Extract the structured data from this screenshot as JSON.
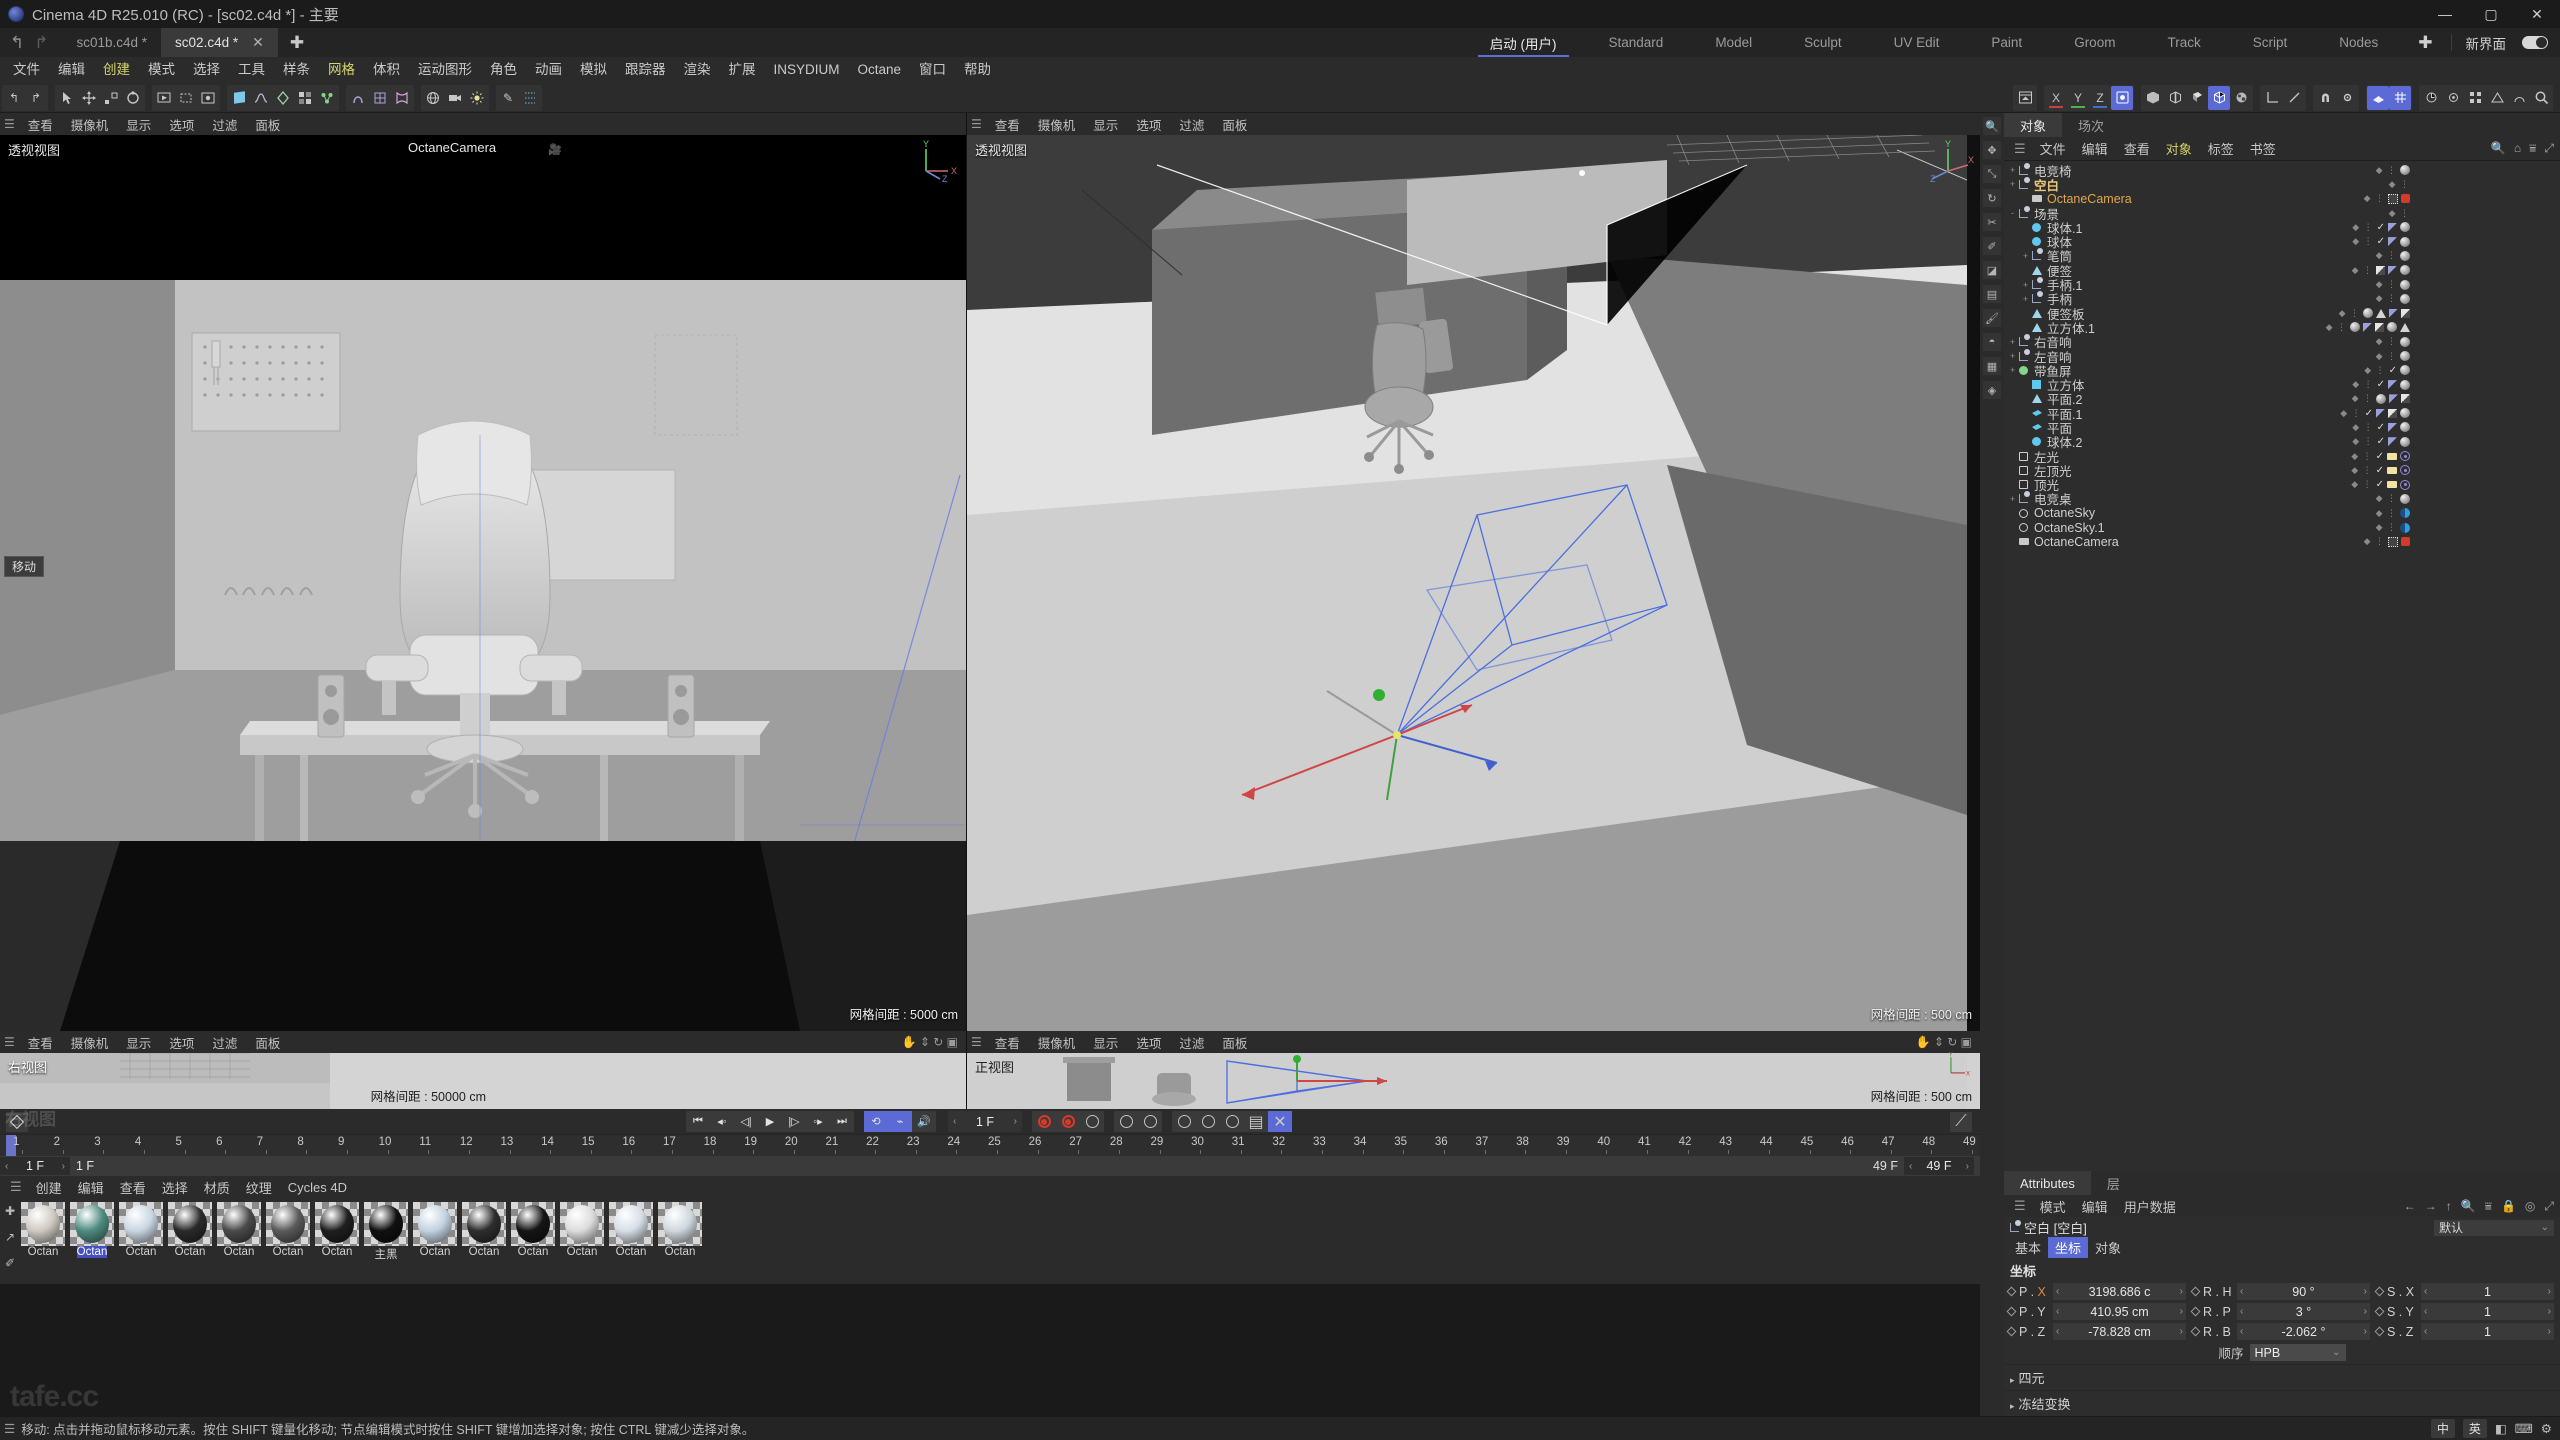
{
  "window": {
    "title": "Cinema 4D R25.010 (RC) - [sc02.c4d *] - 主要",
    "minimize": "—",
    "maximize": "▢",
    "close": "✕"
  },
  "tabs": {
    "undo_icon": "↰",
    "redo_icon": "↱",
    "documents": [
      {
        "label": "sc01b.c4d *",
        "active": false
      },
      {
        "label": "sc02.c4d *",
        "active": true,
        "close": "✕"
      }
    ],
    "add_tab": "✚"
  },
  "layouts": {
    "items": [
      {
        "label": "启动 (用户)",
        "active": true
      },
      {
        "label": "Standard",
        "active": false
      },
      {
        "label": "Model",
        "active": false
      },
      {
        "label": "Sculpt",
        "active": false
      },
      {
        "label": "UV Edit",
        "active": false
      },
      {
        "label": "Paint",
        "active": false
      },
      {
        "label": "Groom",
        "active": false
      },
      {
        "label": "Track",
        "active": false
      },
      {
        "label": "Script",
        "active": false
      },
      {
        "label": "Nodes",
        "active": false
      }
    ],
    "add": "✚",
    "new_ui_label": "新界面"
  },
  "menubar": {
    "items": [
      {
        "label": "文件",
        "highlight": false
      },
      {
        "label": "编辑",
        "highlight": false
      },
      {
        "label": "创建",
        "highlight": true
      },
      {
        "label": "模式",
        "highlight": false
      },
      {
        "label": "选择",
        "highlight": false
      },
      {
        "label": "工具",
        "highlight": false
      },
      {
        "label": "样条",
        "highlight": false
      },
      {
        "label": "网格",
        "highlight": true
      },
      {
        "label": "体积",
        "highlight": false
      },
      {
        "label": "运动图形",
        "highlight": false
      },
      {
        "label": "角色",
        "highlight": false
      },
      {
        "label": "动画",
        "highlight": false
      },
      {
        "label": "模拟",
        "highlight": false
      },
      {
        "label": "跟踪器",
        "highlight": false
      },
      {
        "label": "渲染",
        "highlight": false
      },
      {
        "label": "扩展",
        "highlight": false
      },
      {
        "label": "INSYDIUM",
        "highlight": false
      },
      {
        "label": "Octane",
        "highlight": false
      },
      {
        "label": "窗口",
        "highlight": false
      },
      {
        "label": "帮助",
        "highlight": false
      }
    ]
  },
  "toolbar_right": {
    "axis_x": "X",
    "axis_y": "Y",
    "axis_z": "Z"
  },
  "viewports": {
    "menu": [
      "查看",
      "摄像机",
      "显示",
      "选项",
      "过滤",
      "面板"
    ],
    "top_left": {
      "label": "透视视图",
      "camera": "OctaneCamera",
      "grid": "网格间距 : 5000 cm"
    },
    "top_right": {
      "label": "透视视图",
      "grid": "网格间距 : 500 cm"
    },
    "bottom_left": {
      "label": "右视图",
      "grid": "网格间距 : 50000 cm"
    },
    "bottom_right": {
      "label": "正视图",
      "grid": "网格间距 : 500 cm"
    },
    "move_tooltip": "移动"
  },
  "object_manager": {
    "tabs": [
      {
        "label": "对象",
        "active": true
      },
      {
        "label": "场次",
        "active": false
      }
    ],
    "menu": [
      {
        "label": "文件",
        "highlight": false
      },
      {
        "label": "编辑",
        "highlight": false
      },
      {
        "label": "查看",
        "highlight": false
      },
      {
        "label": "对象",
        "highlight": true
      },
      {
        "label": "标签",
        "highlight": false
      },
      {
        "label": "书签",
        "highlight": false
      }
    ],
    "items": [
      {
        "name": "电竞椅",
        "depth": 0,
        "icon": "null",
        "expand": "+",
        "selected": false,
        "check": false,
        "tags": [
          "mat"
        ]
      },
      {
        "name": "空白",
        "depth": 0,
        "icon": "null",
        "expand": "+",
        "selected": true,
        "check": false,
        "tags": []
      },
      {
        "name": "OctaneCamera",
        "depth": 1,
        "icon": "cam",
        "expand": "",
        "selected": false,
        "camsel": true,
        "check": false,
        "tags": [
          "camtag",
          "red"
        ]
      },
      {
        "name": "场景",
        "depth": 0,
        "icon": "null",
        "expand": "-",
        "selected": false,
        "check": false,
        "tags": []
      },
      {
        "name": "球体.1",
        "depth": 1,
        "icon": "sphere",
        "expand": "",
        "selected": false,
        "check": true,
        "tags": [
          "uv",
          "mat"
        ]
      },
      {
        "name": "球体",
        "depth": 1,
        "icon": "sphere",
        "expand": "",
        "selected": false,
        "check": true,
        "tags": [
          "uv",
          "mat"
        ]
      },
      {
        "name": "笔筒",
        "depth": 1,
        "icon": "null",
        "expand": "+",
        "selected": false,
        "check": false,
        "tags": [
          "mat"
        ]
      },
      {
        "name": "便签",
        "depth": 1,
        "icon": "poly",
        "expand": "",
        "selected": false,
        "check": false,
        "tags": [
          "sq",
          "uv",
          "mat"
        ]
      },
      {
        "name": "手柄.1",
        "depth": 1,
        "icon": "null",
        "expand": "+",
        "selected": false,
        "check": false,
        "tags": [
          "mat"
        ]
      },
      {
        "name": "手柄",
        "depth": 1,
        "icon": "null",
        "expand": "+",
        "selected": false,
        "check": false,
        "tags": [
          "mat"
        ]
      },
      {
        "name": "便签板",
        "depth": 1,
        "icon": "poly",
        "expand": "",
        "selected": false,
        "check": false,
        "tags": [
          "mat",
          "tri",
          "uv",
          "sq"
        ]
      },
      {
        "name": "立方体.1",
        "depth": 1,
        "icon": "poly",
        "expand": "",
        "selected": false,
        "check": false,
        "tags": [
          "mat",
          "uv",
          "sq",
          "mat",
          "tri"
        ]
      },
      {
        "name": "右音响",
        "depth": 0,
        "icon": "null",
        "expand": "+",
        "selected": false,
        "check": false,
        "tags": [
          "mat"
        ]
      },
      {
        "name": "左音响",
        "depth": 0,
        "icon": "null",
        "expand": "+",
        "selected": false,
        "check": false,
        "tags": [
          "mat"
        ]
      },
      {
        "name": "带鱼屏",
        "depth": 0,
        "icon": "mograph",
        "expand": "+",
        "selected": false,
        "check": true,
        "tags": [
          "mat"
        ]
      },
      {
        "name": "立方体",
        "depth": 1,
        "icon": "cube",
        "expand": "",
        "selected": false,
        "check": true,
        "tags": [
          "uv",
          "mat"
        ]
      },
      {
        "name": "平面.2",
        "depth": 1,
        "icon": "poly",
        "expand": "",
        "selected": false,
        "check": false,
        "tags": [
          "mat",
          "uv",
          "sq"
        ]
      },
      {
        "name": "平面.1",
        "depth": 1,
        "icon": "plane",
        "expand": "",
        "selected": false,
        "check": true,
        "tags": [
          "uv",
          "sq",
          "mat"
        ]
      },
      {
        "name": "平面",
        "depth": 1,
        "icon": "plane",
        "expand": "",
        "selected": false,
        "check": true,
        "tags": [
          "uv",
          "mat"
        ]
      },
      {
        "name": "球体.2",
        "depth": 1,
        "icon": "sphere",
        "expand": "",
        "selected": false,
        "check": true,
        "tags": [
          "uv",
          "mat"
        ]
      },
      {
        "name": "左光",
        "depth": 0,
        "icon": "light",
        "expand": "",
        "selected": false,
        "check": true,
        "tags": [
          "lt",
          "target"
        ]
      },
      {
        "name": "左顶光",
        "depth": 0,
        "icon": "light",
        "expand": "",
        "selected": false,
        "check": true,
        "tags": [
          "lt",
          "target"
        ]
      },
      {
        "name": "顶光",
        "depth": 0,
        "icon": "light",
        "expand": "",
        "selected": false,
        "check": true,
        "tags": [
          "lt",
          "target"
        ]
      },
      {
        "name": "电竞桌",
        "depth": 0,
        "icon": "null",
        "expand": "+",
        "selected": false,
        "check": false,
        "tags": [
          "mat"
        ]
      },
      {
        "name": "OctaneSky",
        "depth": 0,
        "icon": "sky",
        "expand": "",
        "selected": false,
        "check": false,
        "tags": [
          "oct"
        ]
      },
      {
        "name": "OctaneSky.1",
        "depth": 0,
        "icon": "sky",
        "expand": "",
        "selected": false,
        "check": false,
        "tags": [
          "oct"
        ]
      },
      {
        "name": "OctaneCamera",
        "depth": 0,
        "icon": "cam",
        "expand": "",
        "selected": false,
        "check": false,
        "tags": [
          "camtag",
          "red"
        ]
      }
    ]
  },
  "attributes": {
    "tabs": [
      {
        "label": "Attributes",
        "active": true
      },
      {
        "label": "层",
        "active": false
      }
    ],
    "menu": [
      "模式",
      "编辑",
      "用户数据"
    ],
    "object_title": "空白 [空白]",
    "preset": "默认",
    "subtabs": [
      {
        "label": "基本",
        "active": false
      },
      {
        "label": "坐标",
        "active": true
      },
      {
        "label": "对象",
        "active": false
      }
    ],
    "section_title": "坐标",
    "fields": [
      {
        "label": "P . X",
        "value": "3198.686 c",
        "axis": "X"
      },
      {
        "label": "R . H",
        "value": "90 °"
      },
      {
        "label": "S . X",
        "value": "1"
      },
      {
        "label": "P . Y",
        "value": "410.95 cm"
      },
      {
        "label": "R . P",
        "value": "3 °"
      },
      {
        "label": "S . Y",
        "value": "1"
      },
      {
        "label": "P . Z",
        "value": "-78.828 cm"
      },
      {
        "label": "R . B",
        "value": "-2.062 °"
      },
      {
        "label": "S . Z",
        "value": "1"
      }
    ],
    "order_label": "顺序",
    "order_value": "HPB",
    "fold_rows": [
      "四元",
      "冻结变换"
    ]
  },
  "timeline": {
    "current_frame": "1 F",
    "start_field": "1 F",
    "start_label": "1 F",
    "end_value": "49 F",
    "end_field": "49 F",
    "ticks": [
      1,
      2,
      3,
      4,
      5,
      6,
      7,
      8,
      9,
      10,
      11,
      12,
      13,
      14,
      15,
      16,
      17,
      18,
      19,
      20,
      21,
      22,
      23,
      24,
      25,
      26,
      27,
      28,
      29,
      30,
      31,
      32,
      33,
      34,
      35,
      36,
      37,
      38,
      39,
      40,
      41,
      42,
      43,
      44,
      45,
      46,
      47,
      48,
      49
    ],
    "transport": [
      "⏮",
      "◂◦",
      "◁|",
      "▶",
      "|▷",
      "◦▸",
      "⏭"
    ]
  },
  "material_manager": {
    "menu": [
      "创建",
      "编辑",
      "查看",
      "选择",
      "材质",
      "纹理",
      "Cycles 4D"
    ],
    "materials": [
      {
        "label": "Octan",
        "color": "#cfc9c2",
        "selected": false
      },
      {
        "label": "Octan",
        "color": "#4f8b80",
        "selected": true
      },
      {
        "label": "Octan",
        "color": "#c9d6e2",
        "selected": false
      },
      {
        "label": "Octan",
        "color": "#2a2a2a",
        "selected": false
      },
      {
        "label": "Octan",
        "color": "#4a4a4a",
        "selected": false
      },
      {
        "label": "Octan",
        "color": "#5a5a5a",
        "selected": false
      },
      {
        "label": "Octan",
        "color": "#1f1f1f",
        "selected": false
      },
      {
        "label": "主黑",
        "color": "#101010",
        "selected": false
      },
      {
        "label": "Octan",
        "color": "#c2d2e0",
        "selected": false
      },
      {
        "label": "Octan",
        "color": "#2e2e2e",
        "selected": false
      },
      {
        "label": "Octan",
        "color": "#151515",
        "selected": false
      },
      {
        "label": "Octan",
        "color": "#dcdcdc",
        "selected": false
      },
      {
        "label": "Octan",
        "color": "#d6dee6",
        "selected": false
      },
      {
        "label": "Octan",
        "color": "#cfd8de",
        "selected": false
      }
    ]
  },
  "statusbar": {
    "message": "移动: 点击并拖动鼠标移动元素。按住 SHIFT 键量化移动; 节点编辑模式时按住 SHIFT 键增加选择对象; 按住 CTRL 键减少选择对象。",
    "ime": "中",
    "lang": "英"
  },
  "watermark": {
    "text": "tafe.cc",
    "text2": "右视图"
  },
  "colors": {
    "accent": "#5b6ad4",
    "highlight_yellow": "#d6d36a",
    "selected_object": "#e8c87a",
    "camera_orange": "#e0a84c",
    "record_red": "#d8392b"
  }
}
